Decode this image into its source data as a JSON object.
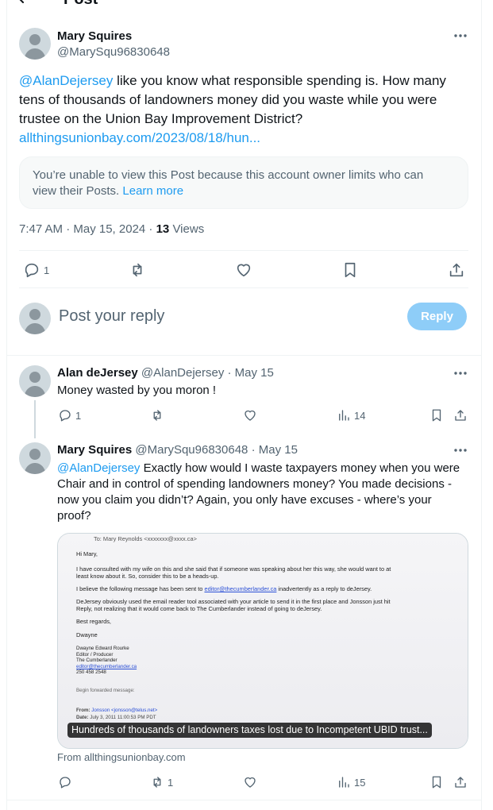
{
  "header": {
    "title": "Post"
  },
  "main_post": {
    "author_name": "Mary Squires",
    "author_handle": "@MarySqu96830648",
    "mention": "@AlanDejersey",
    "text_line1": " like you know what responsible spending is. How many",
    "text_line2": "tens of thousands of landowners money did you waste while you were",
    "text_line3": "trustee on the Union Bay Improvement District?",
    "link": "allthingsunionbay.com/2023/08/18/hun...",
    "notice_text": "You’re unable to view this Post because this account owner limits who can",
    "notice_text2": "view their Posts.",
    "notice_link": "Learn more",
    "time": "7:47 AM · May 15, 2024 · ",
    "views_count": "13",
    "views_label": " Views",
    "reply_count": "1"
  },
  "composer": {
    "placeholder": "Post your reply",
    "button": "Reply"
  },
  "reply1": {
    "author_name": "Alan deJersey",
    "author_handle": "@AlanDejersey",
    "date": "· May 15",
    "text": "Money wasted by you moron !",
    "reply_count": "1",
    "view_count": "14"
  },
  "reply2": {
    "author_name": "Mary Squires",
    "author_handle": "@MarySqu96830648",
    "date": "· May 15",
    "mention": "@AlanDejersey",
    "text_line1": " Exactly how would I waste taxpayers money when you were",
    "text_line2": "Chair and in control of spending landowners money?  You made decisions -",
    "text_line3": "now you claim you didn’t?  Again, you only have excuses - where’s your",
    "text_line4": "proof?",
    "card_caption": "Hundreds of thousands of landowners taxes lost due to Incompetent UBID trust...",
    "card_source": "From allthingsunionbay.com",
    "repost_count": "1",
    "view_count": "15",
    "email": {
      "to_line": "To: Mary Reynolds <xxxxxxx@xxxx.ca>",
      "greeting": "Hi Mary,",
      "p1a": "I have consulted with my wife on this and she said that if someone was speaking about her this way, she would want to at",
      "p1b": "least know about it. So, consider this to be a heads-up.",
      "p2a": "I believe the following message has been sent to ",
      "p2link": "editor@thecumberlander.ca",
      "p2b": " inadvertently as a reply to deJersey.",
      "p3a": "DeJersey obviously used the email reader tool associated with your article to send it in the first place and Jonsson just hit",
      "p3b": "Reply, not realizing that it would come back to The Cumberlander instead of going to deJersey.",
      "regards": "Best regards,",
      "name": "Dwayne",
      "sig1": "Dwayne Edward Rourke",
      "sig2": "Editor / Producer",
      "sig3": "The Cumberlander",
      "sig4": "editor@thecumberlander.ca",
      "sig5": "250 458 2548",
      "fwd": "Begin forwarded message:",
      "from": "From:",
      "from_val": "Jonsson <jonsson@telus.net>",
      "date_l": "Date:",
      "date_val": "July 3, 2011 11:00:53 PM PDT"
    }
  },
  "colors": {
    "accent": "#1d9bf0",
    "muted": "#536471",
    "reply_button_bg": "#8ecdf8"
  }
}
